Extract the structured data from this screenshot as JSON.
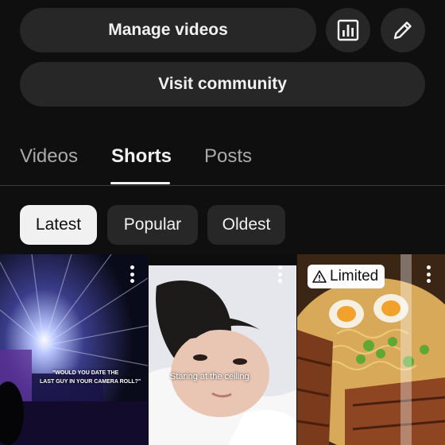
{
  "actions": {
    "manage_label": "Manage videos",
    "visit_label": "Visit community",
    "analytics_icon": "bar-chart-icon",
    "edit_icon": "pencil-icon"
  },
  "tabs": [
    {
      "label": "Videos",
      "selected": false
    },
    {
      "label": "Shorts",
      "selected": true
    },
    {
      "label": "Posts",
      "selected": false
    }
  ],
  "filters": [
    {
      "label": "Latest",
      "selected": true
    },
    {
      "label": "Popular",
      "selected": false
    },
    {
      "label": "Oldest",
      "selected": false
    }
  ],
  "shorts": [
    {
      "caption_lines": [
        "\"WOULD YOU DATE THE",
        "LAST GUY IN YOUR CAMERA ROLL?\""
      ],
      "badge": ""
    },
    {
      "caption": "Staring at the ceiling",
      "badge": ""
    },
    {
      "caption": "",
      "badge": "Limited",
      "badge_icon": "warning-icon"
    }
  ],
  "colors": {
    "background": "#0f0f0f",
    "button": "#272727",
    "text": "#f1f1f1",
    "muted": "#aaaaaa"
  }
}
